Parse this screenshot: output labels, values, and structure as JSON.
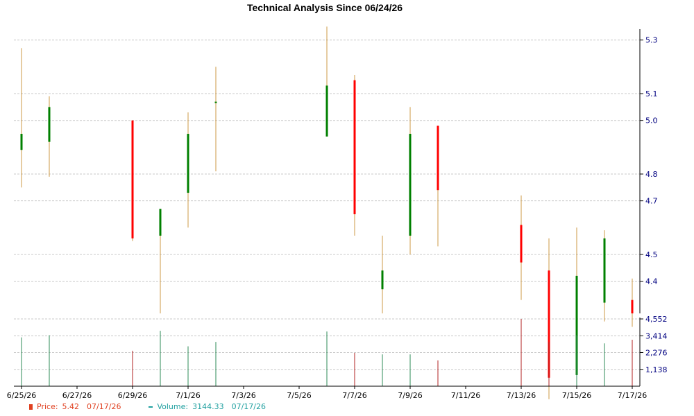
{
  "chart_data": {
    "type": "candlestick",
    "title": "Technical Analysis Since 06/24/26",
    "price_axis": {
      "ylim": [
        4.28,
        5.32
      ],
      "ticks": [
        4.4,
        4.5,
        4.7,
        4.8,
        5.0,
        5.1,
        5.3
      ]
    },
    "volume_axis": {
      "ylim": [
        0,
        4552
      ],
      "ticks": [
        "1,138",
        "2,276",
        "3,414",
        "4,552"
      ]
    },
    "x_tick_labels": [
      "6/25/26",
      "6/27/26",
      "6/29/26",
      "7/1/26",
      "7/3/26",
      "7/5/26",
      "7/7/26",
      "7/9/26",
      "7/11/26",
      "7/13/26",
      "7/15/26",
      "7/17/26"
    ],
    "candles": [
      {
        "date": "6/25/26",
        "open": 4.89,
        "close": 4.95,
        "high": 5.27,
        "low": 4.75,
        "volume": 3300
      },
      {
        "date": "6/26/26",
        "open": 4.92,
        "close": 5.05,
        "high": 5.09,
        "low": 4.79,
        "volume": 3450
      },
      {
        "date": "6/29/26",
        "open": 5.0,
        "close": 4.56,
        "high": 5.0,
        "low": 4.55,
        "volume": 2400
      },
      {
        "date": "6/30/26",
        "open": 4.57,
        "close": 4.67,
        "high": 4.67,
        "low": 4.28,
        "volume": 3750
      },
      {
        "date": "7/1/26",
        "open": 4.73,
        "close": 4.95,
        "high": 5.03,
        "low": 4.6,
        "volume": 2700
      },
      {
        "date": "7/2/26",
        "open": 5.07,
        "close": 5.07,
        "high": 5.2,
        "low": 4.81,
        "volume": 3000
      },
      {
        "date": "7/6/26",
        "open": 4.94,
        "close": 5.13,
        "high": 5.35,
        "low": 4.94,
        "volume": 3700
      },
      {
        "date": "7/7/26",
        "open": 5.15,
        "close": 4.65,
        "high": 5.17,
        "low": 4.57,
        "volume": 2250
      },
      {
        "date": "7/8/26",
        "open": 4.37,
        "close": 4.44,
        "high": 4.57,
        "low": 4.28,
        "volume": 2150
      },
      {
        "date": "7/9/26",
        "open": 4.57,
        "close": 4.95,
        "high": 5.05,
        "low": 4.5,
        "volume": 2150
      },
      {
        "date": "7/10/26",
        "open": 4.98,
        "close": 4.74,
        "high": 4.98,
        "low": 4.53,
        "volume": 1750
      },
      {
        "date": "7/13/26",
        "open": 4.61,
        "close": 4.47,
        "high": 4.72,
        "low": 4.33,
        "volume": 4552
      },
      {
        "date": "7/14/26",
        "open": 4.44,
        "close": 4.04,
        "high": 4.56,
        "low": 3.96,
        "volume": 3000
      },
      {
        "date": "7/15/26",
        "open": 4.05,
        "close": 4.42,
        "high": 4.6,
        "low": 4.0,
        "volume": 3450
      },
      {
        "date": "7/16/26",
        "open": 4.32,
        "close": 4.56,
        "high": 4.59,
        "low": 4.25,
        "volume": 2900
      },
      {
        "date": "7/17/26",
        "open": 4.33,
        "close": 4.28,
        "high": 4.41,
        "low": 4.23,
        "volume": 3144.33
      }
    ],
    "colors": {
      "up": "#008000",
      "down": "#ff0000",
      "wick": "#cc9944",
      "volume_up": "#2e8b57",
      "volume_down": "#b22222",
      "grid": "#c8c8c8",
      "axis": "#000000"
    },
    "legend": [
      {
        "label": "Price:",
        "value": "5.42",
        "date": "07/17/26",
        "color": "#e04020"
      },
      {
        "label": "Volume:",
        "value": "3144.33",
        "date": "07/17/26",
        "color": "#20a0a0"
      }
    ]
  }
}
